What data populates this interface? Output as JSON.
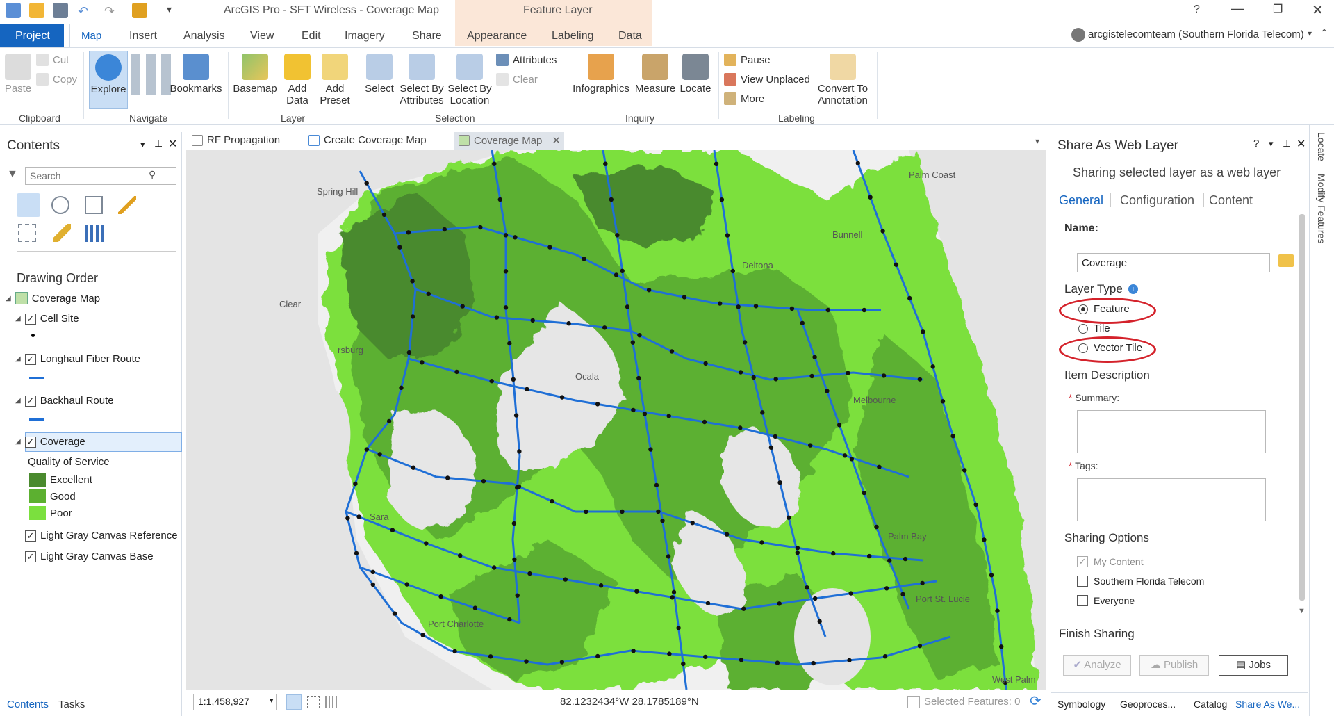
{
  "window": {
    "title": "ArcGIS Pro - SFT Wireless - Coverage Map",
    "contextual_tab_group": "Feature Layer"
  },
  "account": {
    "label": "arcgistelecomteam (Southern Florida Telecom)"
  },
  "ribbon_tabs": [
    "Project",
    "Map",
    "Insert",
    "Analysis",
    "View",
    "Edit",
    "Imagery",
    "Share",
    "Appearance",
    "Labeling",
    "Data"
  ],
  "ribbon": {
    "clipboard": {
      "paste": "Paste",
      "cut": "Cut",
      "copy": "Copy",
      "group": "Clipboard"
    },
    "navigate": {
      "explore": "Explore",
      "bookmarks": "Bookmarks",
      "group": "Navigate"
    },
    "layer": {
      "basemap": "Basemap",
      "add_data": "Add Data",
      "add_preset": "Add Preset",
      "group": "Layer"
    },
    "selection": {
      "select": "Select",
      "select_by_attributes": "Select By Attributes",
      "select_by_location": "Select By Location",
      "attributes": "Attributes",
      "clear": "Clear",
      "group": "Selection"
    },
    "inquiry": {
      "infographics": "Infographics",
      "measure": "Measure",
      "locate": "Locate",
      "group": "Inquiry"
    },
    "labeling": {
      "pause": "Pause",
      "view_unplaced": "View Unplaced",
      "more": "More",
      "convert": "Convert To Annotation",
      "group": "Labeling"
    }
  },
  "contents": {
    "title": "Contents",
    "search_placeholder": "Search",
    "drawing_order": "Drawing Order",
    "map_name": "Coverage Map",
    "layers": [
      {
        "name": "Cell Site"
      },
      {
        "name": "Longhaul Fiber Route"
      },
      {
        "name": "Backhaul Route"
      },
      {
        "name": "Coverage"
      }
    ],
    "qos_heading": "Quality of Service",
    "qos": [
      {
        "label": "Excellent",
        "color": "#4a8a2e"
      },
      {
        "label": "Good",
        "color": "#5cb030"
      },
      {
        "label": "Poor",
        "color": "#7be03e"
      }
    ],
    "basemap_layers": [
      "Light Gray Canvas Reference",
      "Light Gray Canvas Base"
    ],
    "bottom_tabs": [
      "Contents",
      "Tasks"
    ]
  },
  "doc_tabs": [
    "RF Propagation",
    "Create Coverage Map",
    "Coverage Map"
  ],
  "map_labels": [
    "Spring Hill",
    "Clear",
    "rsburg",
    "Sara",
    "Port Charlotte",
    "Bunnell",
    "Melbourne",
    "Palm Bay",
    "Port St. Lucie",
    "West Palm",
    "Deltona",
    "Ocala",
    "Palm Coast"
  ],
  "status": {
    "scale": "1:1,458,927",
    "coords": "82.1232434°W 28.1785189°N",
    "selected": "Selected Features: 0"
  },
  "share_pane": {
    "title": "Share As Web Layer",
    "subtitle": "Sharing selected layer as a web layer",
    "tabs": [
      "General",
      "Configuration",
      "Content"
    ],
    "name_label": "Name:",
    "name_value": "Coverage",
    "layer_type_label": "Layer Type",
    "layer_types": [
      "Feature",
      "Tile",
      "Vector Tile"
    ],
    "item_description": "Item Description",
    "summary_label": "Summary:",
    "tags_label": "Tags:",
    "sharing_options": "Sharing Options",
    "share_targets": [
      "My Content",
      "Southern Florida Telecom",
      "Everyone"
    ],
    "finish_sharing": "Finish Sharing",
    "buttons": {
      "analyze": "Analyze",
      "publish": "Publish",
      "jobs": "Jobs"
    },
    "bottom_tabs": [
      "Symbology",
      "Geoproces...",
      "Catalog",
      "Share As We..."
    ]
  },
  "side_strip": [
    "Locate",
    "Modify Features"
  ],
  "colors": {
    "accent": "#1565c0",
    "highlight": "#d4222b",
    "coverage_excellent": "#4a8a2e",
    "coverage_good": "#5cb030",
    "coverage_poor": "#7be03e",
    "route": "#1f6fd6"
  }
}
